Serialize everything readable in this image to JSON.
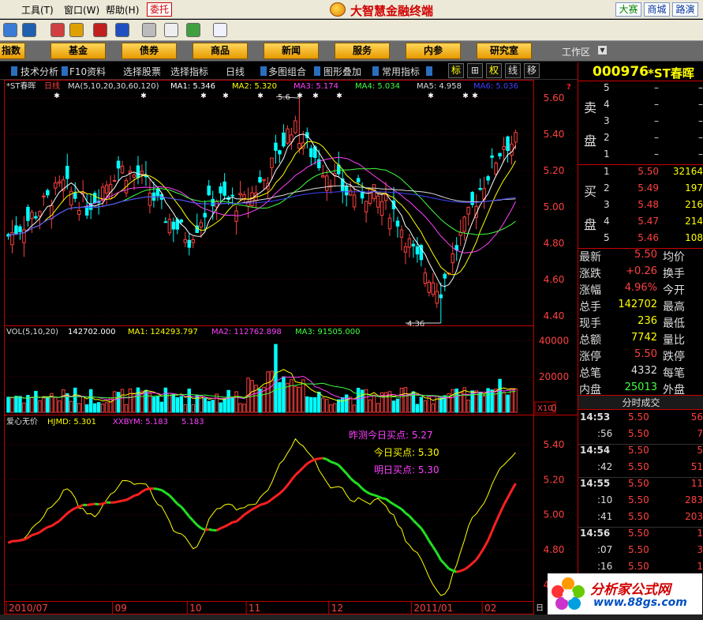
{
  "menu": {
    "items": [
      {
        "label": "工具(T)"
      },
      {
        "label": "窗口(W)"
      },
      {
        "label": "帮助(H)"
      }
    ],
    "weituo_label": "委托",
    "app_title": "大智慧金融终端",
    "window_buttons": [
      {
        "label": "大赛"
      },
      {
        "label": "商城"
      },
      {
        "label": "路演"
      }
    ]
  },
  "categories": [
    {
      "label": "指数"
    },
    {
      "label": "基金"
    },
    {
      "label": "债券"
    },
    {
      "label": "商品"
    },
    {
      "label": "新闻"
    },
    {
      "label": "服务"
    },
    {
      "label": "内参"
    },
    {
      "label": "研究室"
    }
  ],
  "workzone_label": "工作区",
  "functions": [
    {
      "label": "技术分析"
    },
    {
      "label": "F10资料"
    },
    {
      "label": "选择股票"
    },
    {
      "label": "选择指标"
    },
    {
      "label": "日线"
    },
    {
      "label": "多图组合"
    },
    {
      "label": "图形叠加"
    },
    {
      "label": "常用指标"
    }
  ],
  "mode_buttons": [
    {
      "label": "标"
    },
    {
      "label": "⊞"
    },
    {
      "label": "权"
    },
    {
      "label": "线"
    },
    {
      "label": "移"
    }
  ],
  "price_panel": {
    "stock_name": "*ST春晖",
    "period": "日线",
    "ma_params": "MA(5,10,20,30,60,120)",
    "ma": [
      {
        "label": "MA1: 5.346",
        "color": "#ffffff"
      },
      {
        "label": "MA2: 5.320",
        "color": "#ffff00"
      },
      {
        "label": "MA3: 5.174",
        "color": "#ff40ff"
      },
      {
        "label": "MA4: 5.034",
        "color": "#40ff40"
      },
      {
        "label": "MA5: 4.958",
        "color": "#dddddd"
      },
      {
        "label": "MA6: 5.036",
        "color": "#4040ff"
      }
    ],
    "help_mark": "?",
    "y_ticks": [
      "5.60",
      "5.40",
      "5.20",
      "5.00",
      "4.80",
      "4.60",
      "4.40"
    ],
    "y_range": [
      4.36,
      5.64
    ],
    "high_label": "5.6",
    "low_label": "4.36"
  },
  "volume_panel": {
    "params": "VOL(5,10,20)",
    "values": [
      {
        "label": "142702.000",
        "color": "#ffffff"
      },
      {
        "label": "MA1: 124293.797",
        "color": "#ffff00"
      },
      {
        "label": "MA2: 112762.898",
        "color": "#ff40ff"
      },
      {
        "label": "MA3: 91505.000",
        "color": "#40ff40"
      }
    ],
    "y_ticks": [
      "40000",
      "20000",
      "0"
    ],
    "unit": "X10"
  },
  "indicator_panel": {
    "name": "爱心无价",
    "lines": [
      {
        "label": "HJMD: 5.301",
        "color": "#ffff00"
      },
      {
        "label": "XXBYM: 5.183",
        "color": "#ff40ff"
      },
      {
        "label": "5.183",
        "color": "#ff40ff"
      }
    ],
    "notes": [
      {
        "label": "昨测今日买点: 5.27",
        "color": "#ff40ff"
      },
      {
        "label": "今日买点: 5.30",
        "color": "#ffff00"
      },
      {
        "label": "明日买点: 5.30",
        "color": "#ff40ff"
      }
    ],
    "y_ticks": [
      "5.40",
      "5.20",
      "5.00",
      "4.80",
      "4.60"
    ]
  },
  "date_axis": {
    "labels": [
      "2010/07",
      "09",
      "10",
      "11",
      "12",
      "2011/01",
      "02"
    ],
    "corner": "日"
  },
  "quote": {
    "code": "000976",
    "name": "*ST春晖",
    "side_sell": [
      "卖",
      "盘"
    ],
    "side_buy": [
      "买",
      "盘"
    ],
    "sell": [
      {
        "idx": "5",
        "price": "–",
        "vol": "–"
      },
      {
        "idx": "4",
        "price": "–",
        "vol": "–"
      },
      {
        "idx": "3",
        "price": "–",
        "vol": "–"
      },
      {
        "idx": "2",
        "price": "–",
        "vol": "–"
      },
      {
        "idx": "1",
        "price": "–",
        "vol": "–"
      }
    ],
    "buy": [
      {
        "idx": "1",
        "price": "5.50",
        "vol": "32164"
      },
      {
        "idx": "2",
        "price": "5.49",
        "vol": "197"
      },
      {
        "idx": "3",
        "price": "5.48",
        "vol": "216"
      },
      {
        "idx": "4",
        "price": "5.47",
        "vol": "214"
      },
      {
        "idx": "5",
        "price": "5.46",
        "vol": "108"
      }
    ],
    "stats": [
      {
        "label": "最新",
        "value": "5.50",
        "color": "#ff4040",
        "label2": "均价"
      },
      {
        "label": "涨跌",
        "value": "+0.26",
        "color": "#ff4040",
        "label2": "换手"
      },
      {
        "label": "涨幅",
        "value": "4.96%",
        "color": "#ff4040",
        "label2": "今开"
      },
      {
        "label": "总手",
        "value": "142702",
        "color": "#ffff00",
        "label2": "最高"
      },
      {
        "label": "现手",
        "value": "236",
        "color": "#ffff00",
        "label2": "最低"
      },
      {
        "label": "总额",
        "value": "7742",
        "color": "#ffff00",
        "label2": "量比"
      },
      {
        "label": "涨停",
        "value": "5.50",
        "color": "#ff4040",
        "label2": "跌停"
      },
      {
        "label": "总笔",
        "value": "4332",
        "color": "#dddddd",
        "label2": "每笔"
      },
      {
        "label": "内盘",
        "value": "25013",
        "color": "#40ff40",
        "label2": "外盘"
      }
    ],
    "trades_title": "分时成交",
    "trades": [
      {
        "time": "14:53",
        "price": "5.50",
        "vol": "56"
      },
      {
        "time": ":56",
        "price": "5.50",
        "vol": "7"
      },
      {
        "time": "14:54",
        "price": "5.50",
        "vol": "5"
      },
      {
        "time": ":42",
        "price": "5.50",
        "vol": "51"
      },
      {
        "time": "14:55",
        "price": "5.50",
        "vol": "11"
      },
      {
        "time": ":10",
        "price": "5.50",
        "vol": "283"
      },
      {
        "time": ":41",
        "price": "5.50",
        "vol": "203"
      },
      {
        "time": "14:56",
        "price": "5.50",
        "vol": "1"
      },
      {
        "time": ":07",
        "price": "5.50",
        "vol": "3"
      },
      {
        "time": ":16",
        "price": "5.50",
        "vol": "1"
      }
    ]
  },
  "watermark": {
    "name": "分析家公式网",
    "url": "www.88gs.com"
  }
}
